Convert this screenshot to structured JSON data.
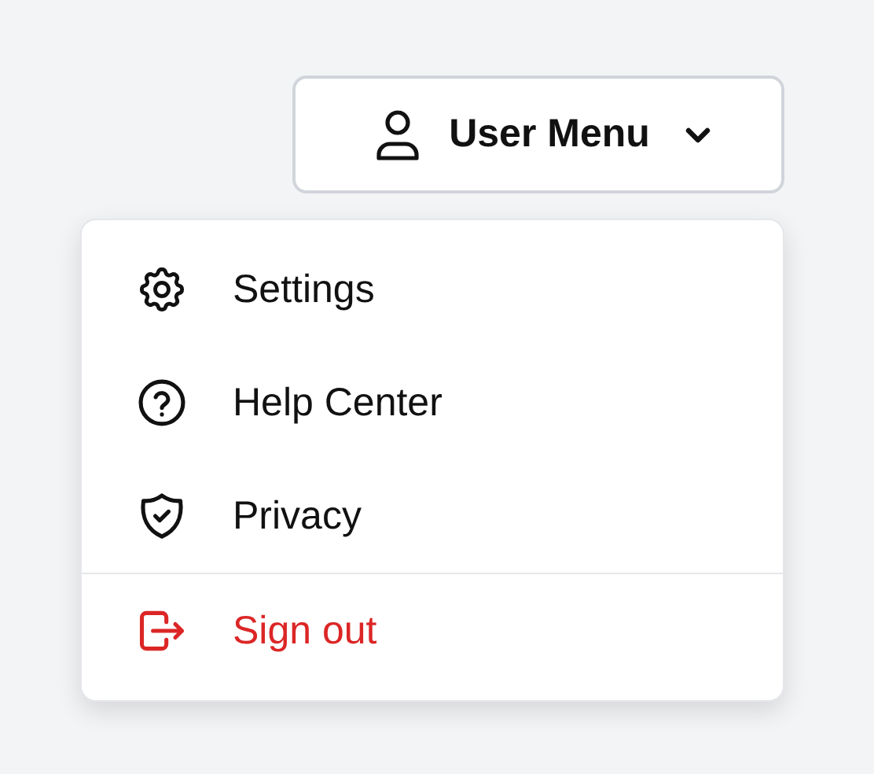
{
  "user_menu": {
    "label": "User Menu",
    "expanded": true
  },
  "menu_items": [
    {
      "label": "Settings",
      "kind": "gear",
      "divider_before": false
    },
    {
      "label": "Help Center",
      "kind": "help",
      "divider_before": false
    },
    {
      "label": "Privacy",
      "kind": "shield",
      "divider_before": false
    },
    {
      "label": "Sign out",
      "kind": "exit",
      "divider_before": true
    }
  ]
}
